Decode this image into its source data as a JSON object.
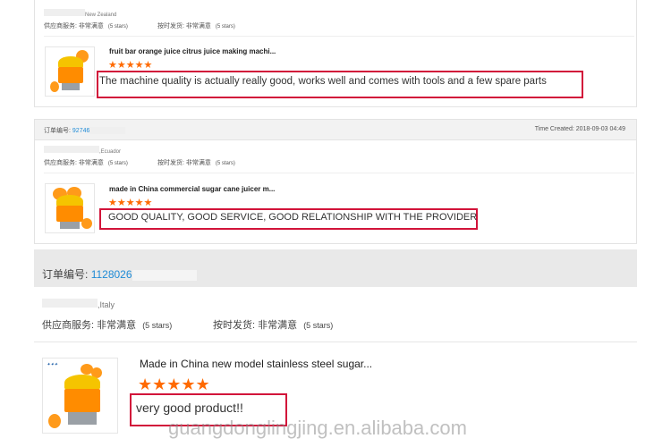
{
  "order1": {
    "country": "New Zealand",
    "supplier_service_label": "供应商服务:",
    "supplier_service_value": "非常满意",
    "supplier_service_stars": "(5 stars)",
    "on_time_label": "按时发货:",
    "on_time_value": "非常满意",
    "on_time_stars": "(5 stars)",
    "product_title": "fruit bar orange juice citrus juice making machi...",
    "stars": "★★★★★",
    "review": "The machine quality is actually really good, works well and comes with tools and a few spare parts"
  },
  "order2": {
    "order_label": "订单编号:",
    "order_number": "92746",
    "time_created": "Time Created: 2018-09-03 04:49",
    "country": ",Ecuador",
    "supplier_service_label": "供应商服务:",
    "supplier_service_value": "非常满意",
    "supplier_service_stars": "(5 stars)",
    "on_time_label": "按时发货:",
    "on_time_value": "非常满意",
    "on_time_stars": "(5 stars)",
    "product_title": "made in China commercial sugar cane juicer m...",
    "stars": "★★★★★",
    "review": "GOOD QUALITY, GOOD SERVICE, GOOD RELATIONSHIP WITH THE PROVIDER"
  },
  "order3": {
    "order_label": "订单编号:",
    "order_number": "1128026",
    "country": ",Italy",
    "supplier_service_label": "供应商服务:",
    "supplier_service_value": "非常满意",
    "supplier_service_stars": "(5 stars)",
    "on_time_label": "按时发货:",
    "on_time_value": "非常满意",
    "on_time_stars": "(5 stars)",
    "product_title": "Made in China new model stainless steel sugar...",
    "stars": "★★★★★",
    "review": "very good product!!"
  },
  "watermark": "guangdonglingjing.en.alibaba.com",
  "colors": {
    "highlight": "#d2143a",
    "star": "#ff6a00",
    "link": "#1f8bd6",
    "header_bg": "#f2f2f2"
  }
}
